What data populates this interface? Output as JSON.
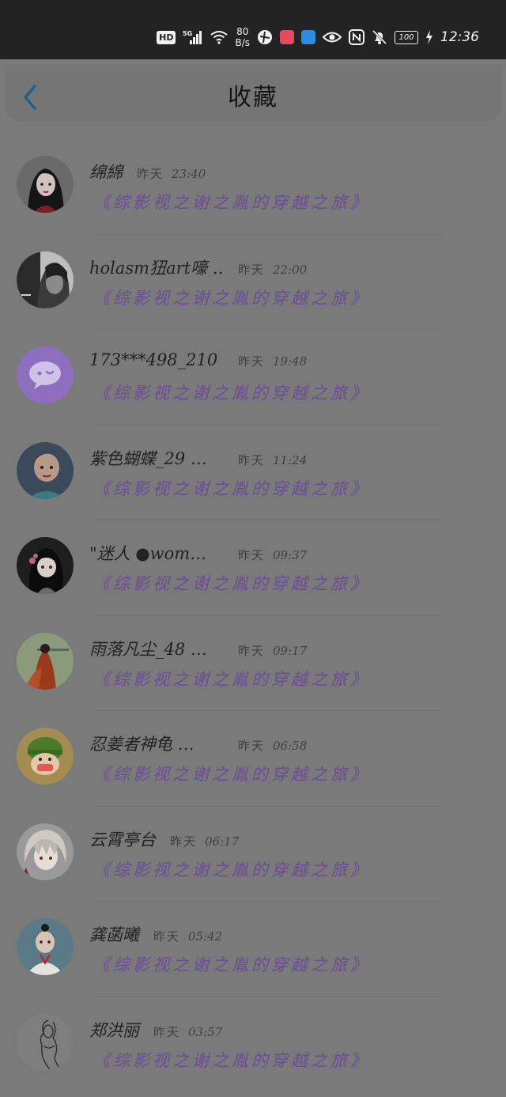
{
  "status_bar": {
    "network_badge": "HD",
    "net_speed_value": "80",
    "net_speed_unit": "B/s",
    "battery": "100",
    "time": "12:36",
    "icons": [
      "hd-icon",
      "5g-signal-icon",
      "wifi-icon",
      "app-icon",
      "app-icon",
      "cloud-icon",
      "eye-icon",
      "nfc-icon",
      "mute-bell-icon",
      "battery-icon",
      "charging-icon"
    ]
  },
  "header": {
    "title": "收藏",
    "back_icon": "chevron-left-icon",
    "accent_color": "#1f5f8f"
  },
  "items": [
    {
      "name": "绵綿",
      "day": "昨天",
      "time": "23:40",
      "book": "《综影视之谢之胤的穿越之旅》"
    },
    {
      "name": "holasm狃art嚎 …",
      "day": "昨天",
      "time": "22:00",
      "book": "《综影视之谢之胤的穿越之旅》"
    },
    {
      "name": "173***498_210 …",
      "day": "昨天",
      "time": "19:48",
      "book": "《综影视之谢之胤的穿越之旅》"
    },
    {
      "name": "紫色蝴蝶_29 …",
      "day": "昨天",
      "time": "11:24",
      "book": "《综影视之谢之胤的穿越之旅》"
    },
    {
      "name": "\"迷人 ●wom…",
      "day": "昨天",
      "time": "09:37",
      "book": "《综影视之谢之胤的穿越之旅》"
    },
    {
      "name": "雨落凡尘_48 …",
      "day": "昨天",
      "time": "09:17",
      "book": "《综影视之谢之胤的穿越之旅》"
    },
    {
      "name": "忍姜者神龟 …",
      "day": "昨天",
      "time": "06:58",
      "book": "《综影视之谢之胤的穿越之旅》"
    },
    {
      "name": "云霄亭台",
      "day": "昨天",
      "time": "06:17",
      "book": "《综影视之谢之胤的穿越之旅》"
    },
    {
      "name": "龚菡曦",
      "day": "昨天",
      "time": "05:42",
      "book": "《综影视之谢之胤的穿越之旅》"
    },
    {
      "name": "郑洪丽",
      "day": "昨天",
      "time": "03:57",
      "book": "《综影视之谢之胤的穿越之旅》"
    }
  ],
  "colors": {
    "overlay_bg": "#7a7a7a",
    "book_title": "#6a4c99",
    "default_avatar": "#8e6fbf"
  }
}
